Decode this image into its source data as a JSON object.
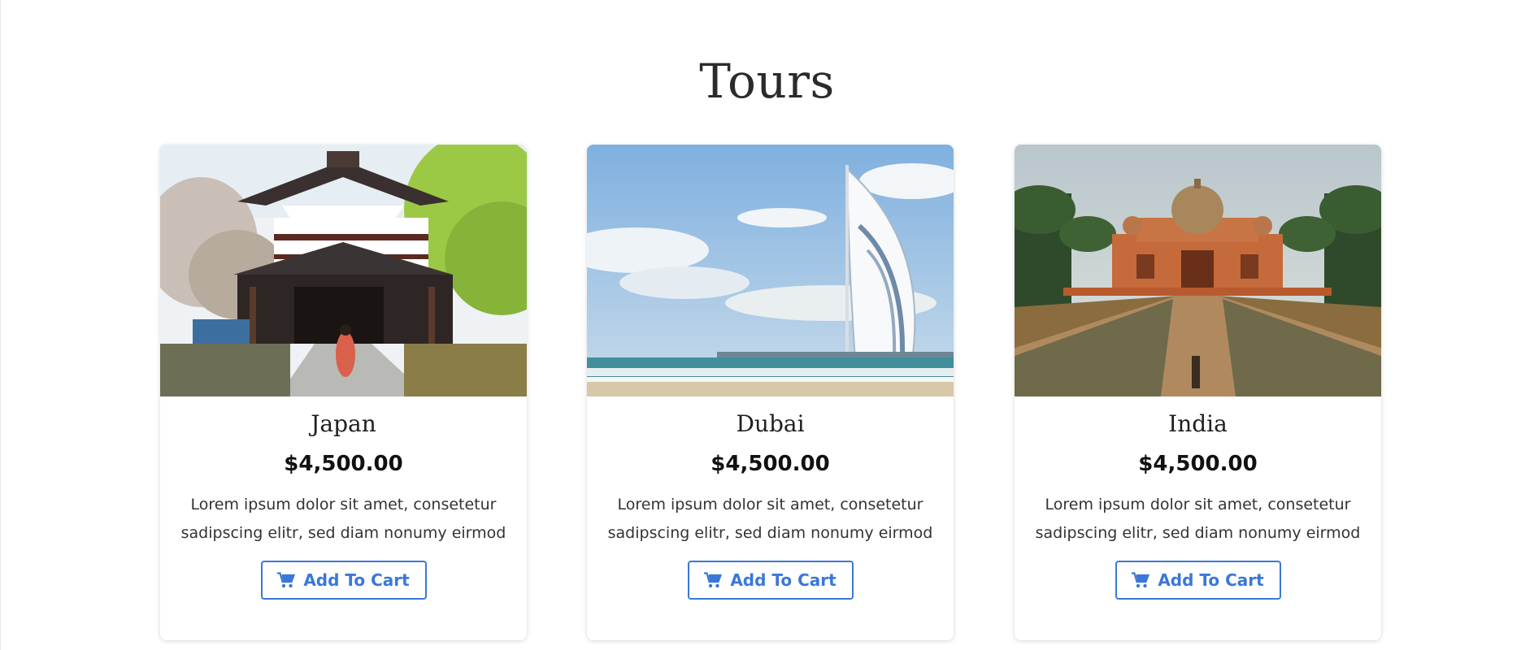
{
  "section": {
    "title": "Tours"
  },
  "cards": [
    {
      "destination": "Japan",
      "price": "$4,500.00",
      "description": "Lorem ipsum dolor sit amet, consetetur sadipscing elitr, sed diam nonumy eirmod",
      "button_label": "Add To Cart",
      "image": "japanese-temple-photo",
      "button_icon": "shopping-cart-icon"
    },
    {
      "destination": "Dubai",
      "price": "$4,500.00",
      "description": "Lorem ipsum dolor sit amet, consetetur sadipscing elitr, sed diam nonumy eirmod",
      "button_label": "Add To Cart",
      "image": "burj-al-arab-beach-photo",
      "button_icon": "shopping-cart-icon"
    },
    {
      "destination": "India",
      "price": "$4,500.00",
      "description": "Lorem ipsum dolor sit amet, consetetur sadipscing elitr, sed diam nonumy eirmod",
      "button_label": "Add To Cart",
      "image": "indian-tomb-palace-photo",
      "button_icon": "shopping-cart-icon"
    }
  ],
  "colors": {
    "accent": "#3a78d8",
    "title_text": "#2b2b2b",
    "price_text": "#111111"
  }
}
